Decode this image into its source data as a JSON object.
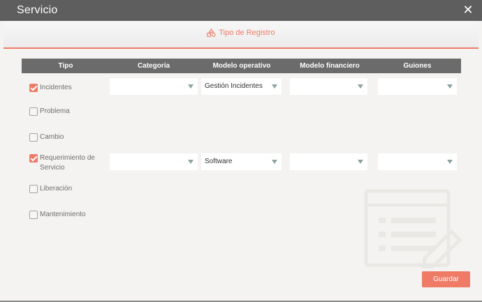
{
  "dialog": {
    "title": "Servicio",
    "close_glyph": "✕"
  },
  "tabs": [
    {
      "label": "Tipo de Registro",
      "icon": "shapes-icon",
      "active": true
    }
  ],
  "table": {
    "headers": [
      "Tipo",
      "Categoría",
      "Modelo operativo",
      "Modelo financiero",
      "Guiones"
    ],
    "rows": [
      {
        "label": "Incidentes",
        "checked": true,
        "selects": [
          "",
          "Gestión Incidentes",
          "",
          ""
        ]
      },
      {
        "label": "Problema",
        "checked": false
      },
      {
        "label": "Cambio",
        "checked": false
      },
      {
        "label": "Requerimiento de Servicio",
        "checked": true,
        "selects": [
          "",
          "Software",
          "",
          ""
        ]
      },
      {
        "label": "Liberación",
        "checked": false
      },
      {
        "label": "Mantenimiento",
        "checked": false
      }
    ]
  },
  "buttons": {
    "save_label": "Guardar"
  },
  "colors": {
    "accent": "#ef7b67",
    "header": "#6b6b6b",
    "titlebar": "#5e5e5e"
  }
}
